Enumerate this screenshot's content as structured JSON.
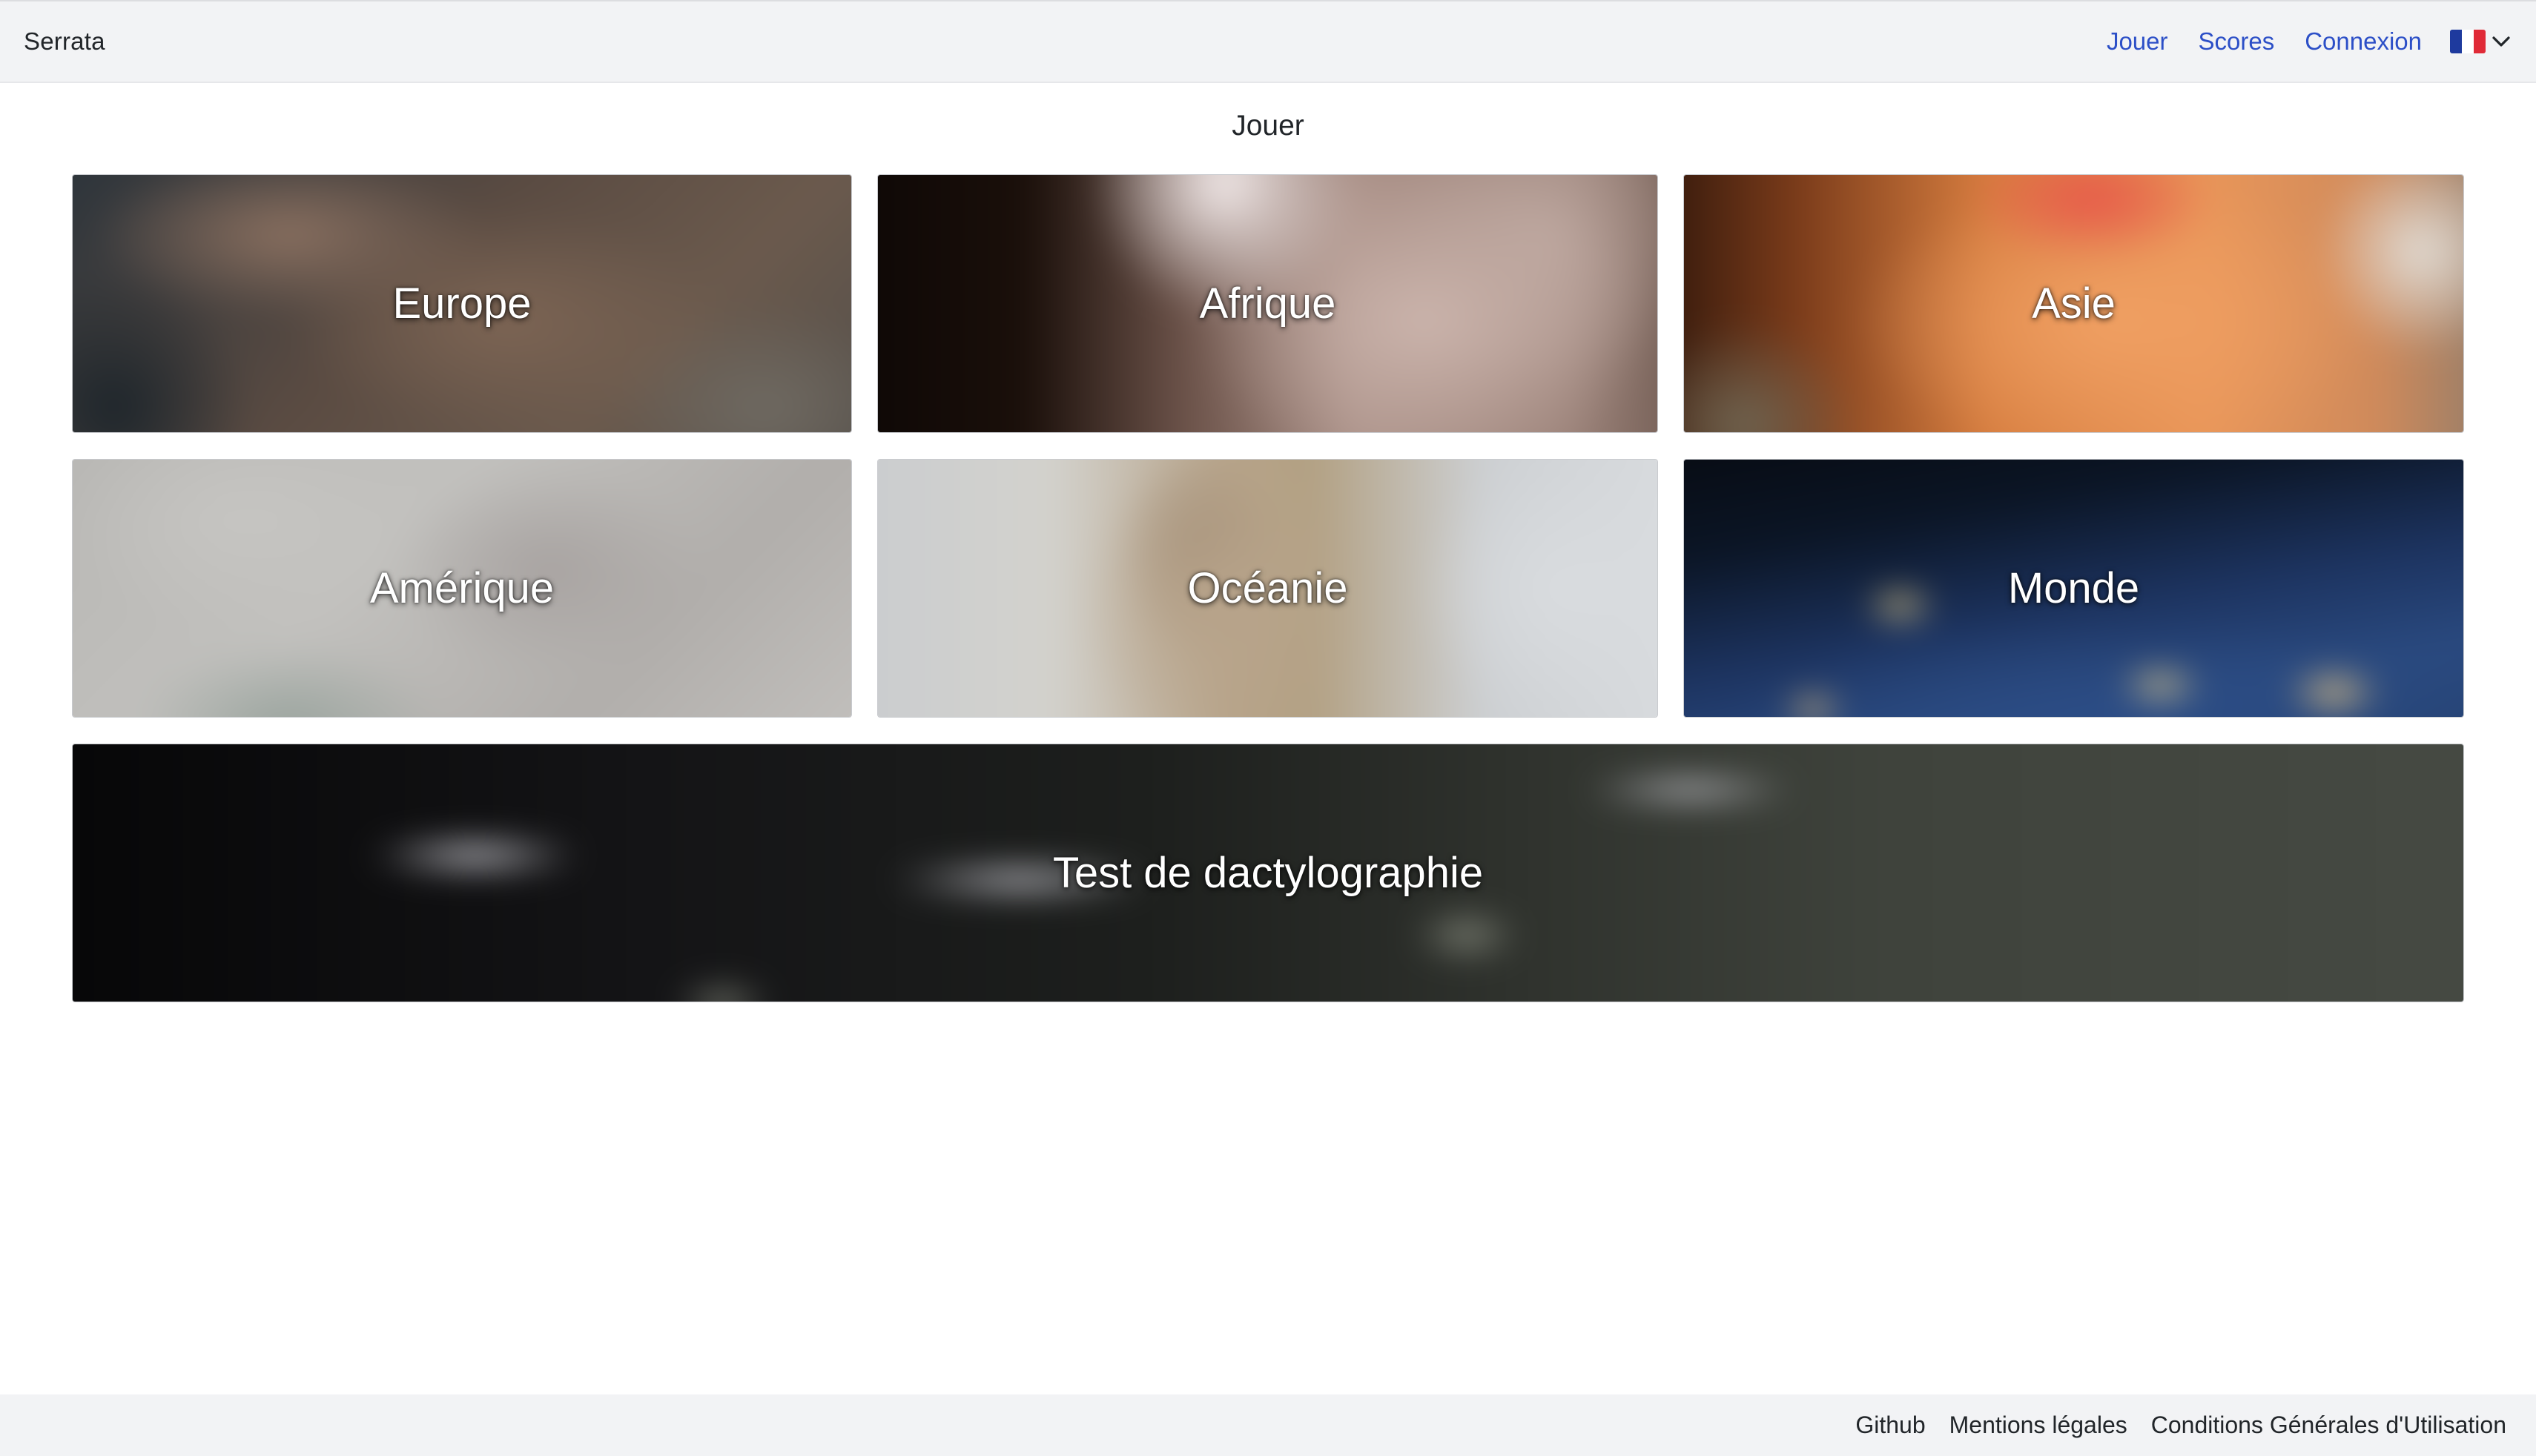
{
  "header": {
    "brand": "Serrata",
    "nav": [
      {
        "label": "Jouer"
      },
      {
        "label": "Scores"
      },
      {
        "label": "Connexion"
      }
    ],
    "language": {
      "flag": "france-flag-icon",
      "flag_colors": [
        "#1e3a9e",
        "#ffffff",
        "#e02a37"
      ],
      "chevron": "chevron-down-icon"
    },
    "link_color": "#2c4fc7"
  },
  "main": {
    "title": "Jouer",
    "cards": [
      {
        "id": "europe",
        "label": "Europe"
      },
      {
        "id": "afrique",
        "label": "Afrique"
      },
      {
        "id": "asie",
        "label": "Asie"
      },
      {
        "id": "amerique",
        "label": "Amérique"
      },
      {
        "id": "oceanie",
        "label": "Océanie"
      },
      {
        "id": "monde",
        "label": "Monde"
      },
      {
        "id": "dactylo",
        "label": "Test de dactylographie"
      }
    ]
  },
  "footer": {
    "links": [
      {
        "label": "Github"
      },
      {
        "label": "Mentions légales"
      },
      {
        "label": "Conditions Générales d'Utilisation"
      }
    ]
  }
}
